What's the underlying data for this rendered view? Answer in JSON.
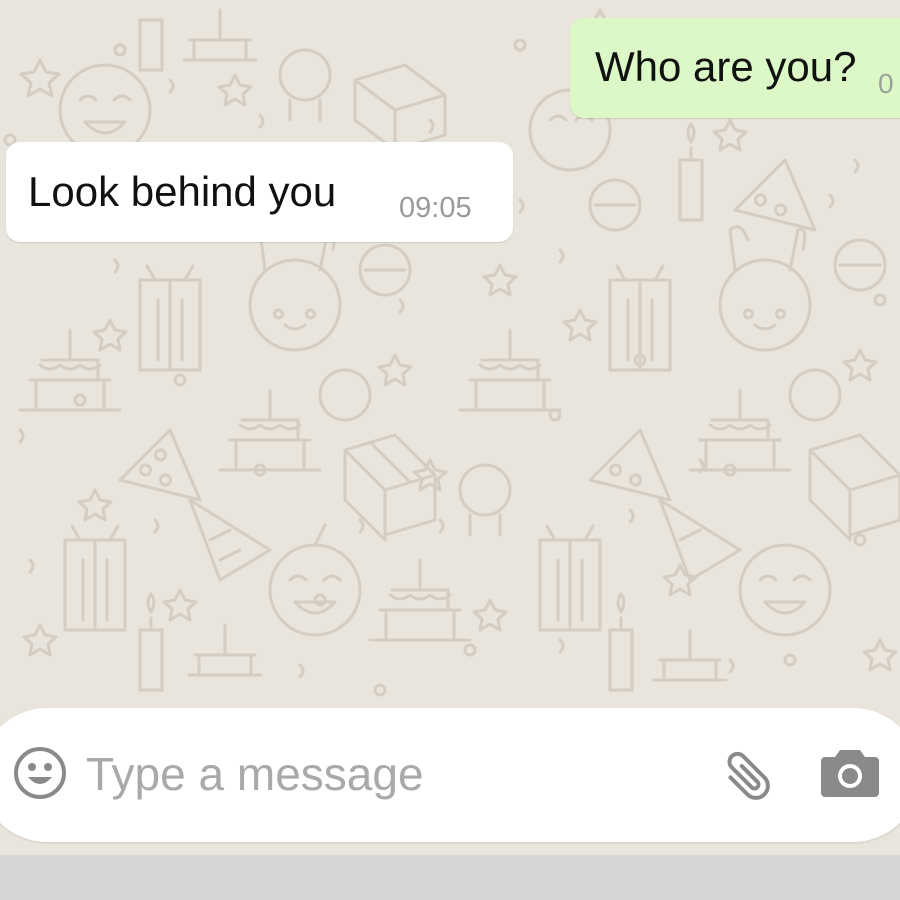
{
  "chat": {
    "messages": [
      {
        "direction": "outgoing",
        "text": "Who are you?",
        "time": "0"
      },
      {
        "direction": "incoming",
        "text": "Look behind you",
        "time": "09:05"
      }
    ]
  },
  "composer": {
    "placeholder": "Type a message",
    "value": "",
    "icons": {
      "emoji": "emoji-icon",
      "attach": "paperclip-icon",
      "camera": "camera-icon"
    }
  },
  "colors": {
    "wallpaper": "#e9e4dc",
    "outgoing_bubble": "#dcf8c6",
    "incoming_bubble": "#ffffff",
    "icon_gray": "#8a8a8a",
    "bottom_strip": "#d6d6d4"
  }
}
